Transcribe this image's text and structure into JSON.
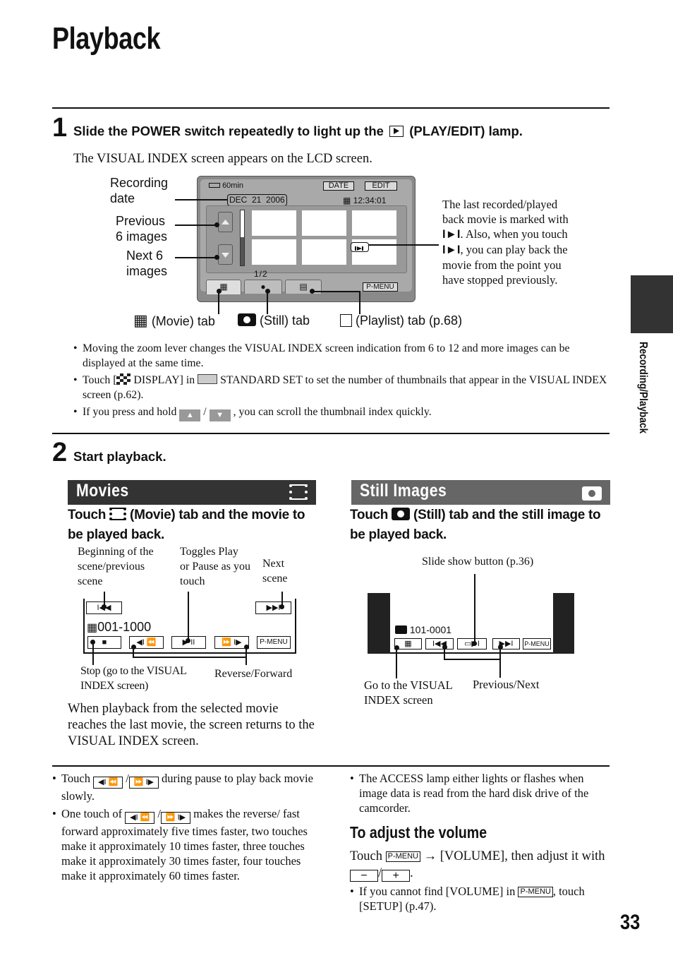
{
  "page": {
    "title": "Playback",
    "number": "33",
    "side_tab_label": "Recording/Playback"
  },
  "step1": {
    "number": "1",
    "instruction_pre": "Slide the POWER switch repeatedly to light up the",
    "instruction_icon": "play-edit-icon",
    "instruction_post": "(PLAY/EDIT) lamp.",
    "subtext": "The VISUAL INDEX screen appears on the LCD screen."
  },
  "lcd": {
    "battery": "60min",
    "date_button": "DATE",
    "edit_button": "EDIT",
    "recording_date": "DEC  21  2006",
    "time": "12:34:01",
    "page_indicator": "1/2",
    "pmenu_button": "P-MENU",
    "tabs": [
      {
        "name": "movie",
        "icon": "film-icon",
        "active": true
      },
      {
        "name": "still",
        "icon": "camera-icon",
        "active": false
      },
      {
        "name": "playlist",
        "icon": "playlist-icon",
        "active": false
      }
    ],
    "thumbnail_count": 6
  },
  "callouts": {
    "recording_date": "Recording\ndate",
    "previous": "Previous\n6 images",
    "next": "Next 6\nimages",
    "movie_tab": "(Movie) tab",
    "still_tab": "(Still) tab",
    "playlist_tab": "(Playlist) tab (p.68)",
    "last_movie_lines": [
      "The last recorded/played",
      "back movie is marked with",
      ". Also, when you touch",
      ", you can play back the",
      "movie from the point you",
      "have stopped previously."
    ]
  },
  "step1_bullets": {
    "b1": "Moving the zoom lever changes the VISUAL INDEX screen indication from 6 to 12 and more images can be displayed at the same time.",
    "b2_pre": "Touch [",
    "b2_mid1": " DISPLAY] in ",
    "b2_post": " STANDARD SET to set the number of thumbnails that appear in the VISUAL INDEX screen (p.62).",
    "b3_pre": "If you press and hold ",
    "b3_sep": " / ",
    "b3_post": " , you can scroll the thumbnail index quickly."
  },
  "step2": {
    "number": "2",
    "instruction": "Start playback."
  },
  "movies": {
    "bar_title": "Movies",
    "bar_color": "#333333",
    "heading_pre": "Touch ",
    "heading_post": " (Movie) tab and the movie to be played back.",
    "label_beginning": "Beginning of the\nscene/previous\nscene",
    "label_toggle": "Toggles Play\nor Pause as you\ntouch",
    "label_next": "Next\nscene",
    "label_stop": "Stop (go to the VISUAL\nINDEX screen)",
    "label_revfwd": "Reverse/Forward",
    "file_number": "001-1000",
    "pmenu": "P-MENU",
    "note": "When playback from the selected movie reaches the last movie, the screen returns to the VISUAL INDEX screen."
  },
  "stills": {
    "bar_title": "Still Images",
    "bar_color": "#666666",
    "heading_pre": "Touch ",
    "heading_post": " (Still) tab and the still image to be played back.",
    "label_slideshow": "Slide show button (p.36)",
    "label_visual_index": "Go to the VISUAL\nINDEX screen",
    "label_prevnext": "Previous/Next",
    "file_number": "101-0001",
    "pmenu": "P-MENU"
  },
  "bottom_left": {
    "b1_pre": "Touch ",
    "b1_post": " during pause to play back movie slowly.",
    "b2_pre": "One touch of ",
    "b2_post": " makes the reverse/ fast forward approximately five times faster, two touches make it approximately 10 times faster, three touches make it approximately 30 times faster, four touches make it approximately 60 times faster.",
    "sep": "/"
  },
  "bottom_right": {
    "b1": "The ACCESS lamp either lights or flashes when image data is read from the hard disk drive of the camcorder.",
    "volume_heading": "To adjust the volume",
    "volume_pre": "Touch ",
    "volume_pmenu": "P-MENU",
    "volume_mid": " → [VOLUME], then adjust it with ",
    "volume_minus": "−",
    "volume_sep": "/",
    "volume_plus": "+",
    "volume_end": ".",
    "b2_pre": "If you cannot find [VOLUME] in ",
    "b2_pmenu": "P-MENU",
    "b2_post": ", touch [SETUP] (p.47)."
  }
}
